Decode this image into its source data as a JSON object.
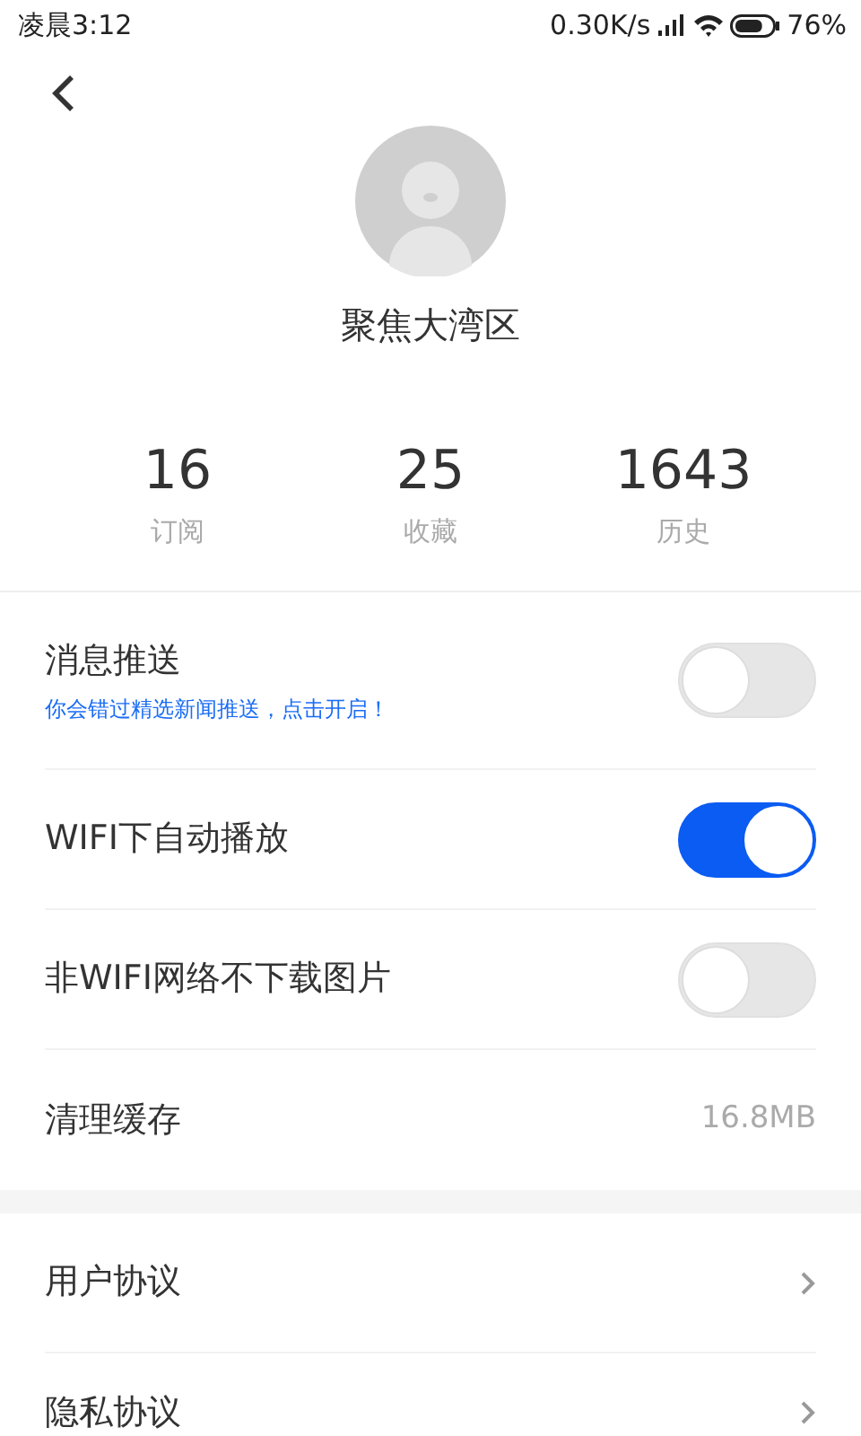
{
  "status_bar": {
    "time": "凌晨3:12",
    "speed": "0.30K/s",
    "battery": "76%"
  },
  "profile": {
    "name": "聚焦大湾区"
  },
  "stats": [
    {
      "value": "16",
      "label": "订阅"
    },
    {
      "value": "25",
      "label": "收藏"
    },
    {
      "value": "1643",
      "label": "历史"
    }
  ],
  "settings": [
    {
      "kind": "toggle",
      "label": "消息推送",
      "hint": "你会错过精选新闻推送，点击开启！",
      "on": false
    },
    {
      "kind": "toggle",
      "label": "WIFI下自动播放",
      "on": true
    },
    {
      "kind": "toggle",
      "label": "非WIFI网络不下载图片",
      "on": false
    },
    {
      "kind": "value",
      "label": "清理缓存",
      "value": "16.8MB"
    }
  ],
  "links": [
    {
      "label": "用户协议"
    },
    {
      "label": "隐私协议"
    }
  ]
}
